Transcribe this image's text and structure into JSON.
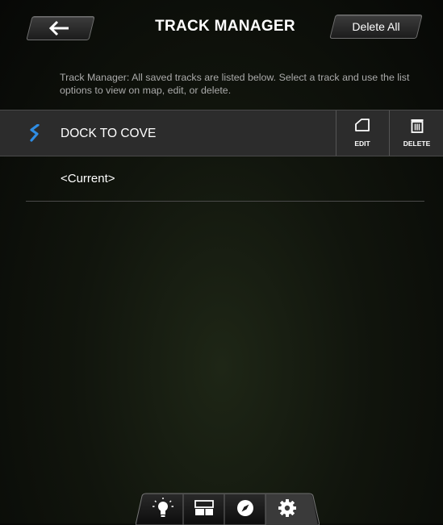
{
  "header": {
    "title": "TRACK MANAGER",
    "back_icon": "arrow-left-icon",
    "delete_all_label": "Delete All"
  },
  "info_text": "Track Manager: All saved tracks are listed below.  Select a track and use the list options to view on map, edit, or delete.",
  "tracks": [
    {
      "name": "DOCK TO COVE",
      "icon": "track-icon",
      "selected": true
    },
    {
      "name": "<Current>",
      "selected": false
    }
  ],
  "row_actions": {
    "edit_label": "EDIT",
    "delete_label": "DELETE"
  },
  "bottom_nav": [
    {
      "icon": "lightbulb-icon",
      "active": false
    },
    {
      "icon": "layout-icon",
      "active": false
    },
    {
      "icon": "compass-icon",
      "active": false
    },
    {
      "icon": "gear-icon",
      "active": true
    }
  ],
  "colors": {
    "accent_blue": "#2f8de4",
    "row_selected_bg": "#2c2c2c",
    "text_muted": "#aaaaaa"
  }
}
